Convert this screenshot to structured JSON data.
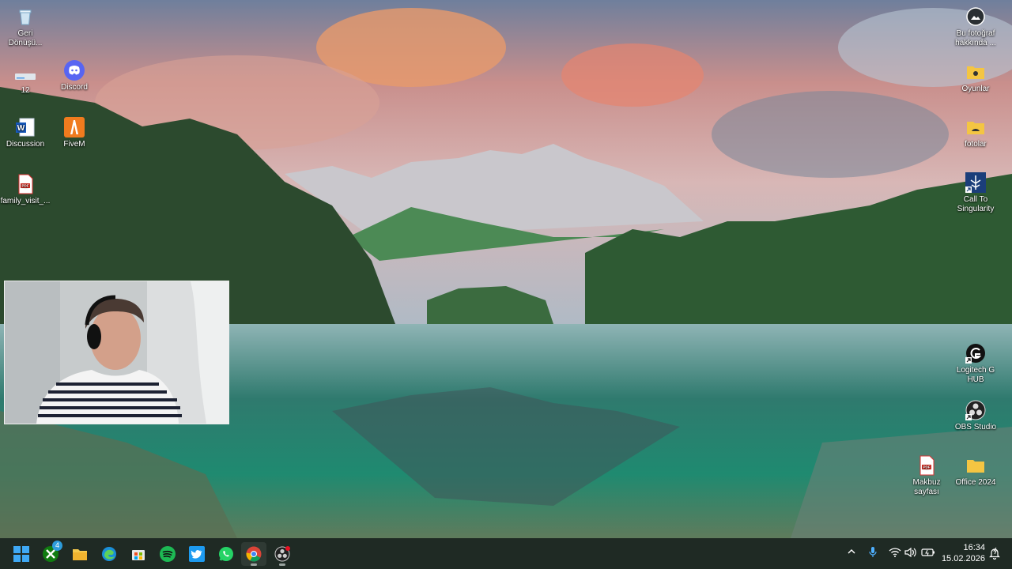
{
  "desktop": {
    "left_icons": [
      {
        "label": "Geri Dönüşü...",
        "icon": "recycle-bin-icon"
      },
      {
        "label": "12",
        "icon": "drive-icon"
      },
      {
        "label": "Discord",
        "icon": "discord-icon"
      },
      {
        "label": "Discussion",
        "icon": "word-document-icon"
      },
      {
        "label": "FiveM",
        "icon": "fivem-icon"
      },
      {
        "label": "family_visit_...",
        "icon": "pdf-icon"
      }
    ],
    "right_icons": [
      {
        "label": "Bu fotoğraf hakkında ...",
        "icon": "about-photo-icon"
      },
      {
        "label": "Oyunlar",
        "icon": "folder-icon"
      },
      {
        "label": "fotolar",
        "icon": "folder-icon"
      },
      {
        "label": "Call To Singularity",
        "icon": "app-shortcut-icon"
      },
      {
        "label": "Logitech G HUB",
        "icon": "logitech-icon"
      },
      {
        "label": "OBS Studio",
        "icon": "obs-icon"
      },
      {
        "label": "Makbuz sayfası",
        "icon": "pdf-icon"
      },
      {
        "label": "Office 2024",
        "icon": "folder-icon"
      }
    ]
  },
  "taskbar": {
    "apps": [
      "start-icon",
      "xbox-icon",
      "file-explorer-icon",
      "edge-icon",
      "store-icon",
      "spotify-icon",
      "twitter-icon",
      "whatsapp-icon",
      "chrome-icon",
      "obs-icon"
    ],
    "xbox_badge": "4",
    "time": "16:34",
    "date": "15.02.2026"
  },
  "colors": {
    "taskbar_bg": "#1f2a24",
    "accent": "#0078d4"
  }
}
